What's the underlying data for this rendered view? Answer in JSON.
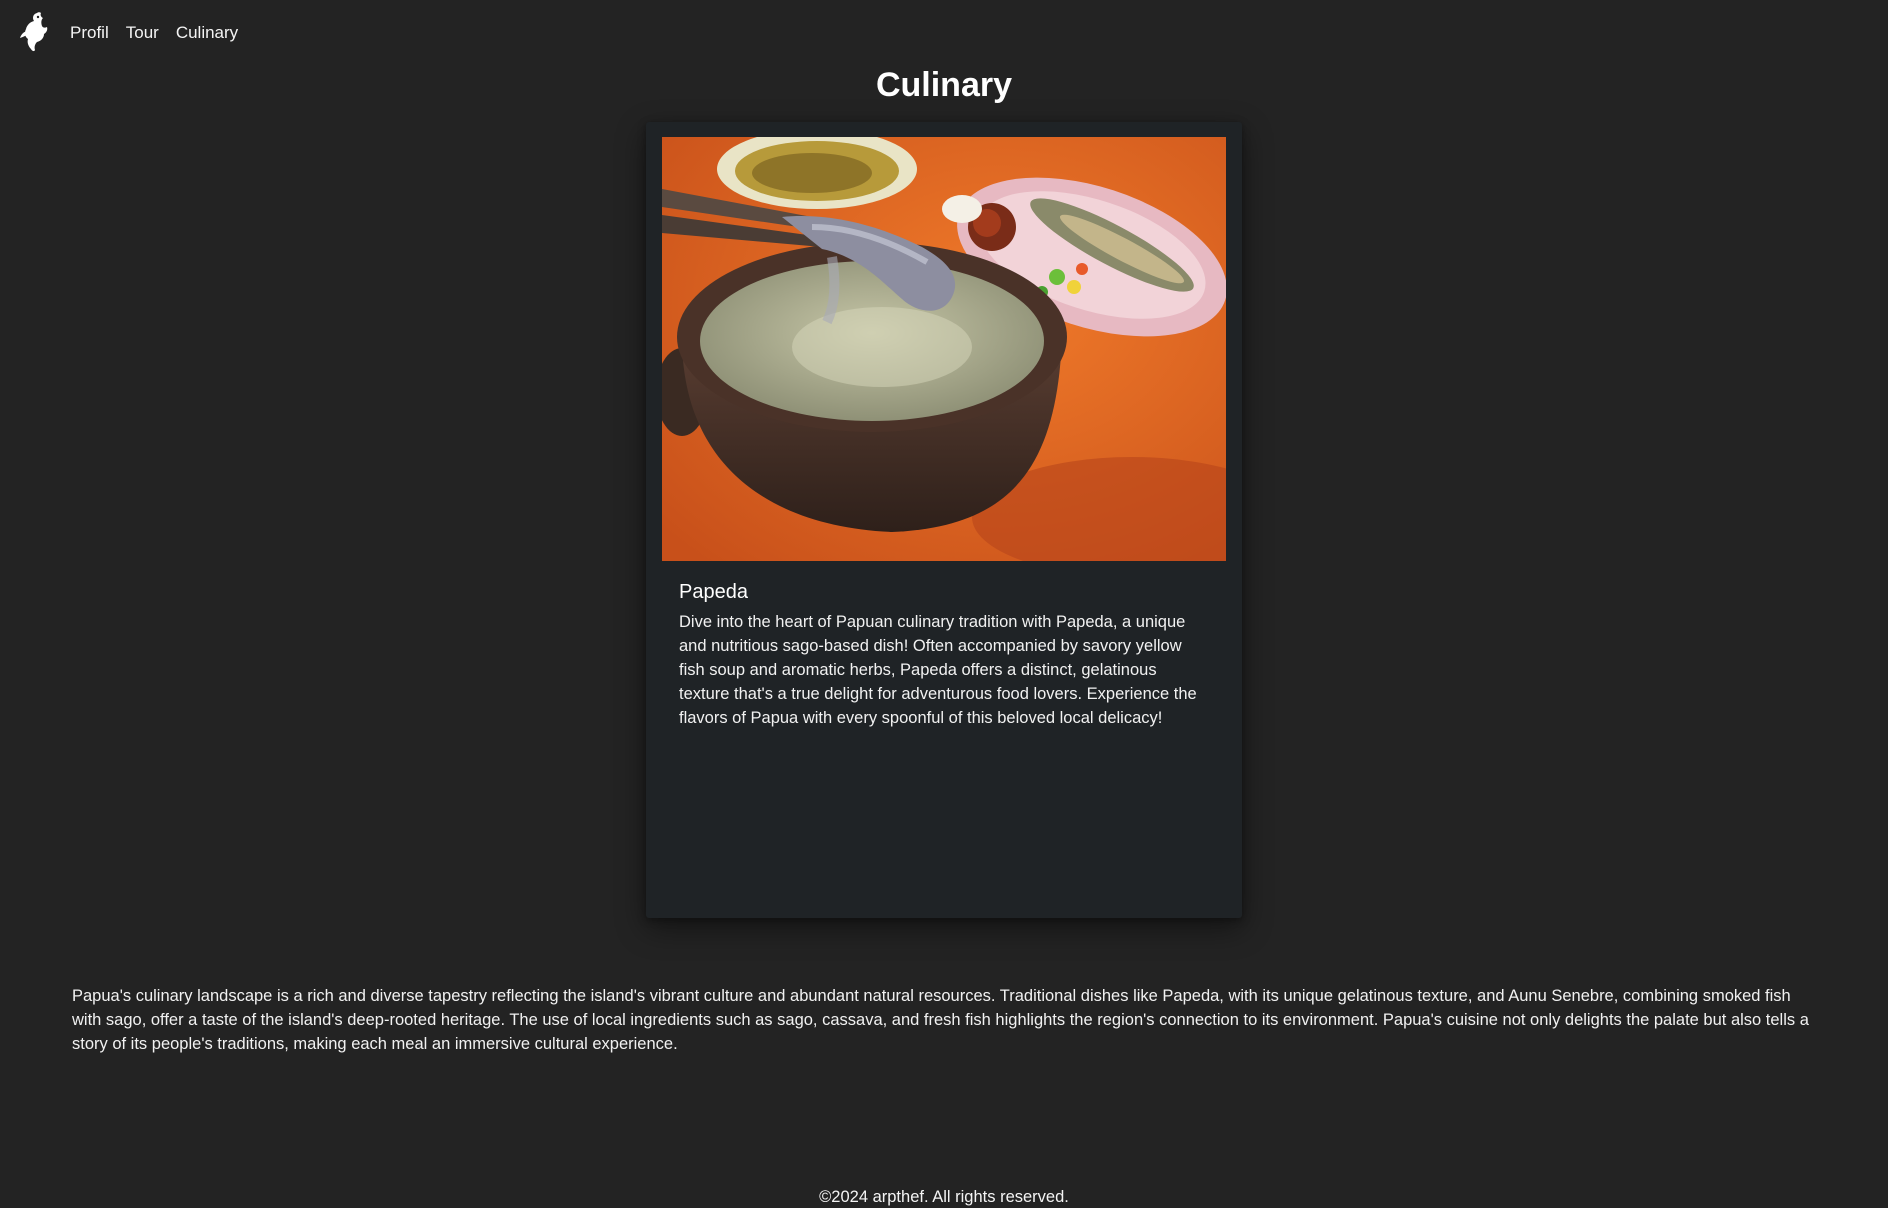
{
  "nav": {
    "logo_icon": "bird-of-paradise-logo-icon",
    "links": [
      {
        "label": "Profil"
      },
      {
        "label": "Tour"
      },
      {
        "label": "Culinary"
      }
    ]
  },
  "page": {
    "title": "Culinary"
  },
  "card": {
    "image_subject": "papeda-dish-photo",
    "title": "Papeda",
    "description": "Dive into the heart of Papuan culinary tradition with Papeda, a unique and nutritious sago-based dish! Often accompanied by savory yellow fish soup and aromatic herbs, Papeda offers a distinct, gelatinous texture that's a true delight for adventurous food lovers. Experience the flavors of Papua with every spoonful of this beloved local delicacy!"
  },
  "about": {
    "text": "Papua's culinary landscape is a rich and diverse tapestry reflecting the island's vibrant culture and abundant natural resources. Traditional dishes like Papeda, with its unique gelatinous texture, and Aunu Senebre, combining smoked fish with sago, offer a taste of the island's deep-rooted heritage. The use of local ingredients such as sago, cassava, and fresh fish highlights the region's connection to its environment. Papua's cuisine not only delights the palate but also tells a story of its people's traditions, making each meal an immersive cultural experience."
  },
  "footer": {
    "copyright": "©2024 arpthef. All rights reserved."
  },
  "colors": {
    "background": "#232323",
    "card_background": "#1f2326",
    "text": "#f2f2f2"
  }
}
